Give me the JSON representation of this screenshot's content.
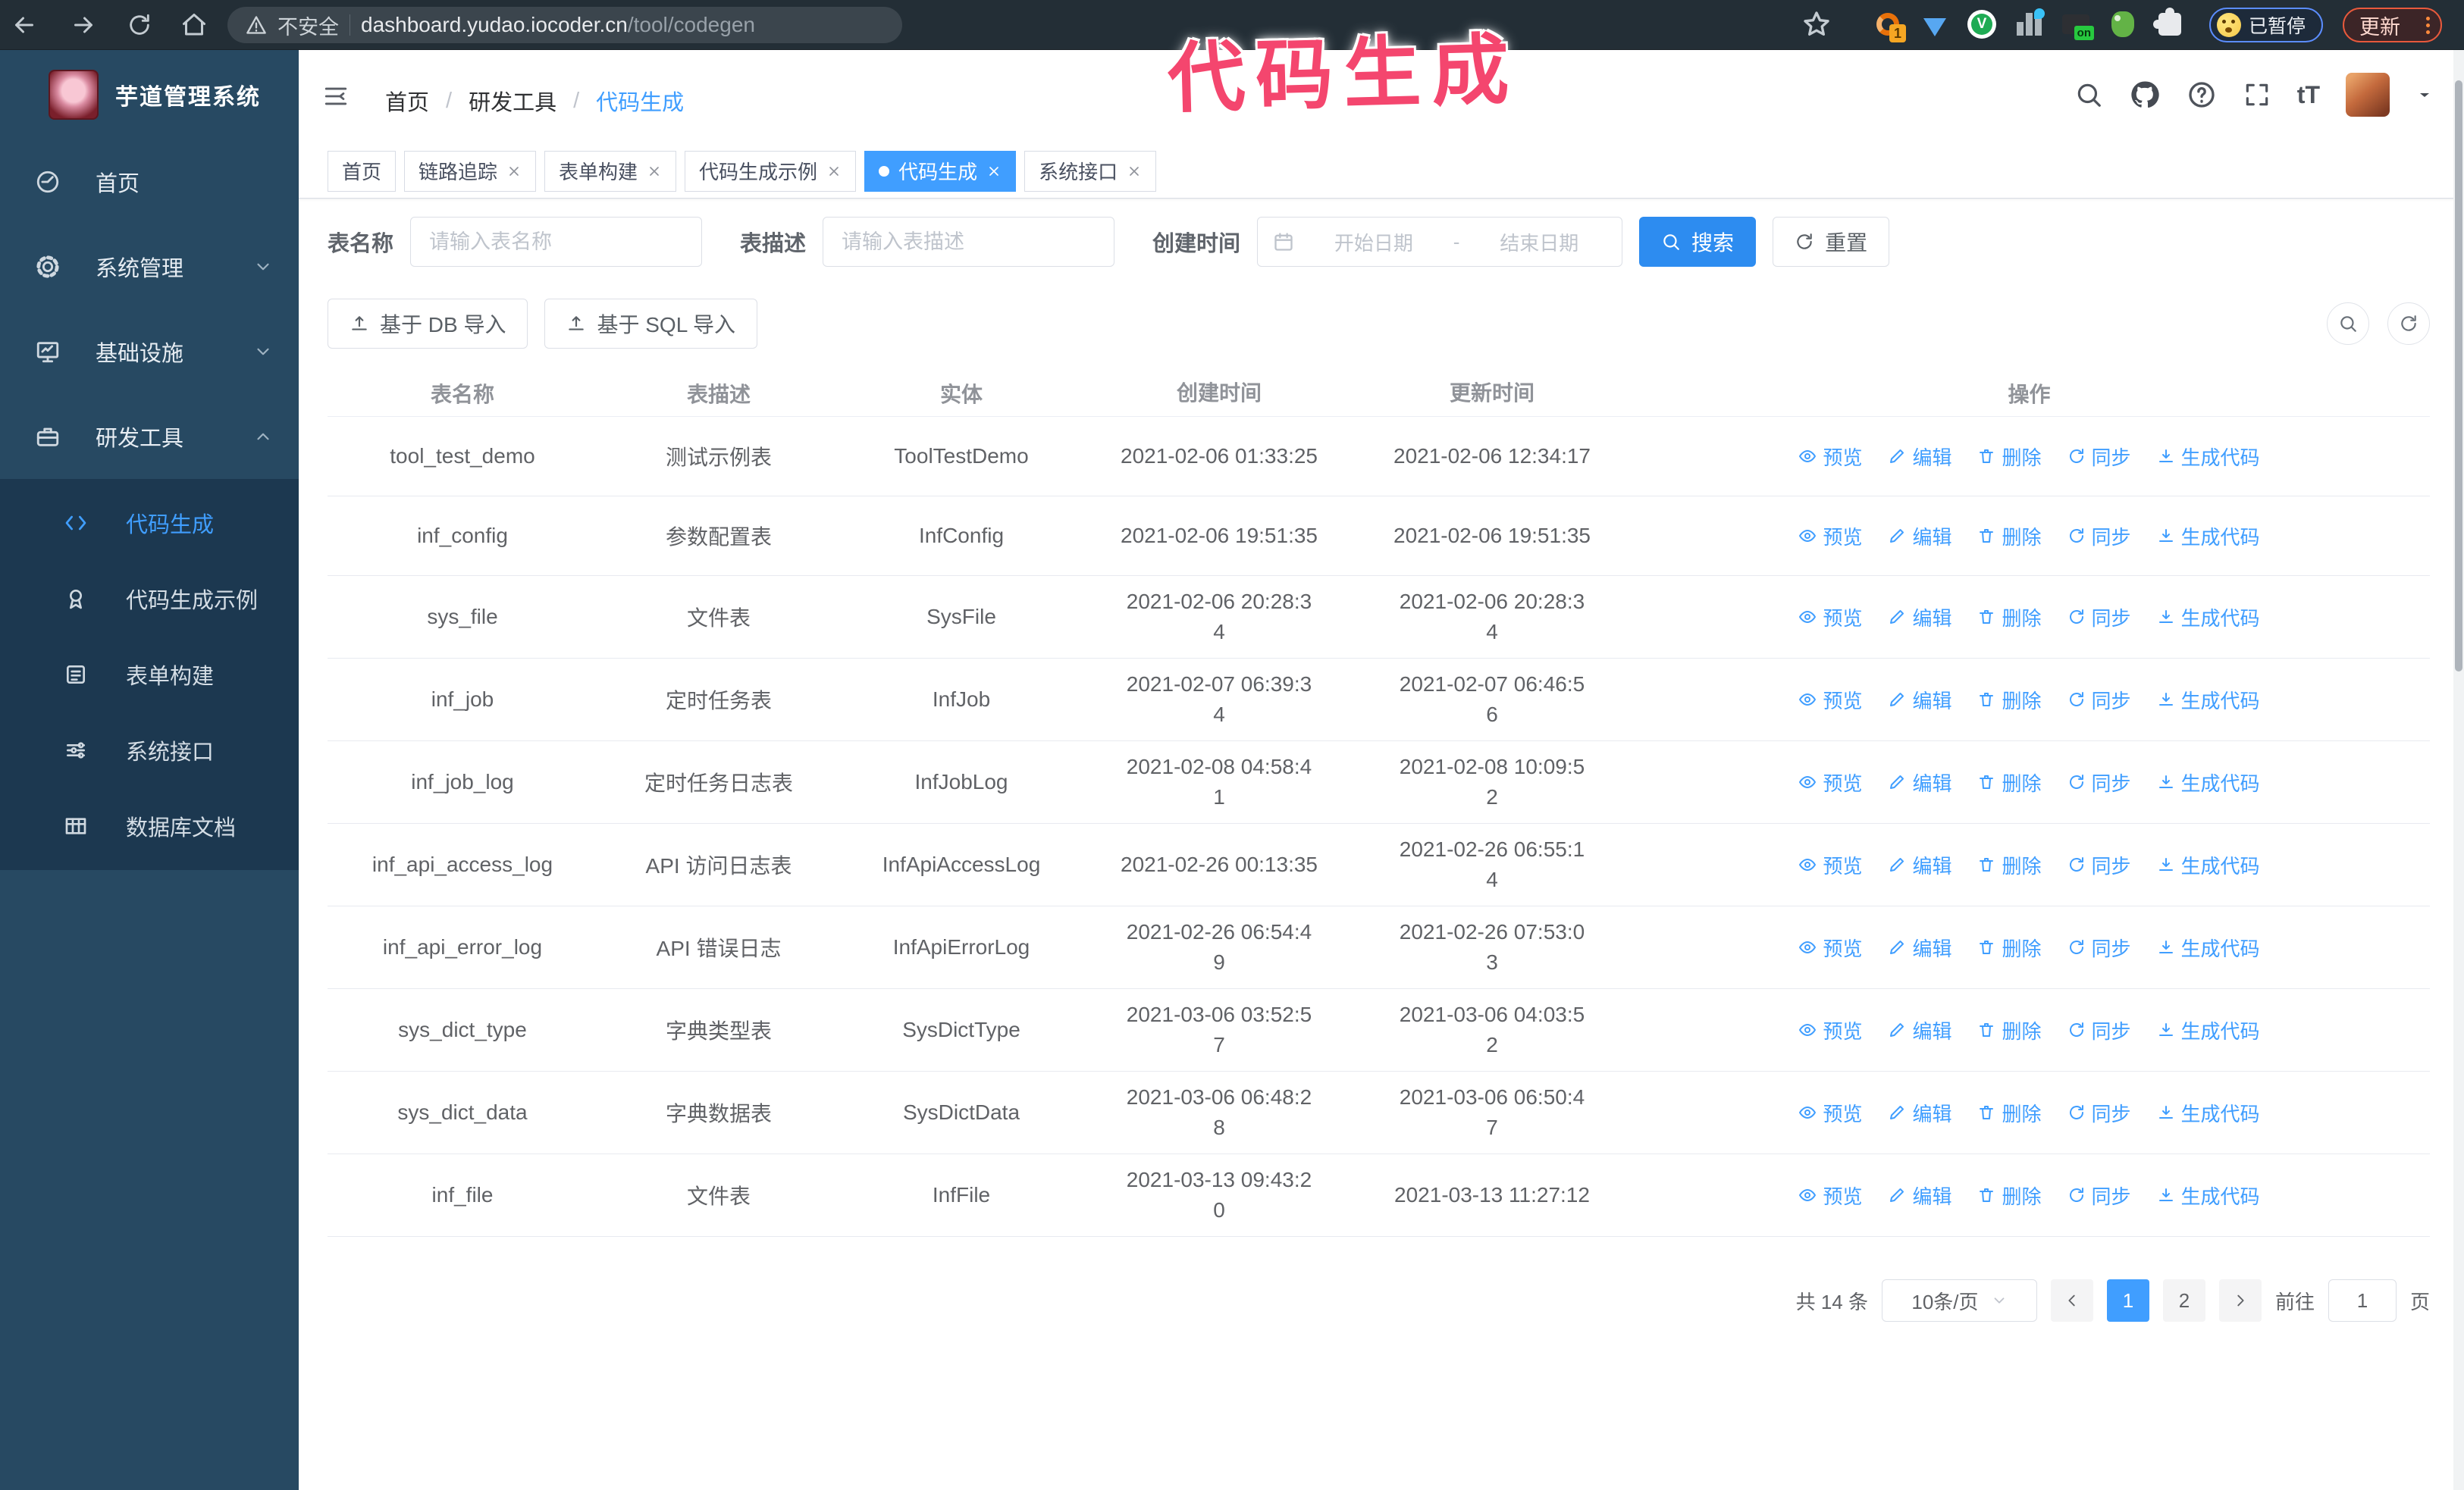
{
  "browser": {
    "security_warning": "不安全",
    "url_domain": "dashboard.yudao.iocoder.cn",
    "url_path": "/tool/codegen",
    "extension_badge_count": "1",
    "extension_on_badge": "on",
    "paused_badge": "已暂停",
    "update_button": "更新"
  },
  "annotation": {
    "text": "代码生成",
    "color": "#f4466e"
  },
  "sidebar": {
    "logo_title": "芋道管理系统",
    "items": [
      {
        "label": "首页"
      },
      {
        "label": "系统管理"
      },
      {
        "label": "基础设施"
      },
      {
        "label": "研发工具"
      }
    ],
    "submenu": [
      {
        "label": "代码生成"
      },
      {
        "label": "代码生成示例"
      },
      {
        "label": "表单构建"
      },
      {
        "label": "系统接口"
      },
      {
        "label": "数据库文档"
      }
    ]
  },
  "header": {
    "breadcrumb": [
      "首页",
      "研发工具",
      "代码生成"
    ],
    "separator": "/"
  },
  "tags": [
    {
      "label": "首页"
    },
    {
      "label": "链路追踪"
    },
    {
      "label": "表单构建"
    },
    {
      "label": "代码生成示例"
    },
    {
      "label": "代码生成"
    },
    {
      "label": "系统接口"
    }
  ],
  "search": {
    "name_label": "表名称",
    "name_placeholder": "请输入表名称",
    "desc_label": "表描述",
    "desc_placeholder": "请输入表描述",
    "time_label": "创建时间",
    "start_placeholder": "开始日期",
    "range_separator": "-",
    "end_placeholder": "结束日期",
    "search_label": "搜索",
    "reset_label": "重置"
  },
  "toolbar": {
    "db_import": "基于 DB 导入",
    "sql_import": "基于 SQL 导入"
  },
  "table": {
    "columns": [
      "表名称",
      "表描述",
      "实体",
      "创建时间",
      "更新时间",
      "操作"
    ],
    "actions": [
      "预览",
      "编辑",
      "删除",
      "同步",
      "生成代码"
    ],
    "rows": [
      {
        "name": "tool_test_demo",
        "desc": "测试示例表",
        "entity": "ToolTestDemo",
        "created": "2021-02-06 01:33:25",
        "updated": "2021-02-06 12:34:17"
      },
      {
        "name": "inf_config",
        "desc": "参数配置表",
        "entity": "InfConfig",
        "created": "2021-02-06 19:51:35",
        "updated": "2021-02-06 19:51:35"
      },
      {
        "name": "sys_file",
        "desc": "文件表",
        "entity": "SysFile",
        "created": "2021-02-06 20:28:3\n4",
        "updated": "2021-02-06 20:28:3\n4"
      },
      {
        "name": "inf_job",
        "desc": "定时任务表",
        "entity": "InfJob",
        "created": "2021-02-07 06:39:3\n4",
        "updated": "2021-02-07 06:46:5\n6"
      },
      {
        "name": "inf_job_log",
        "desc": "定时任务日志表",
        "entity": "InfJobLog",
        "created": "2021-02-08 04:58:4\n1",
        "updated": "2021-02-08 10:09:5\n2"
      },
      {
        "name": "inf_api_access_log",
        "desc": "API 访问日志表",
        "entity": "InfApiAccessLog",
        "created": "2021-02-26 00:13:35",
        "updated": "2021-02-26 06:55:1\n4"
      },
      {
        "name": "inf_api_error_log",
        "desc": "API 错误日志",
        "entity": "InfApiErrorLog",
        "created": "2021-02-26 06:54:4\n9",
        "updated": "2021-02-26 07:53:0\n3"
      },
      {
        "name": "sys_dict_type",
        "desc": "字典类型表",
        "entity": "SysDictType",
        "created": "2021-03-06 03:52:5\n7",
        "updated": "2021-03-06 04:03:5\n2"
      },
      {
        "name": "sys_dict_data",
        "desc": "字典数据表",
        "entity": "SysDictData",
        "created": "2021-03-06 06:48:2\n8",
        "updated": "2021-03-06 06:50:4\n7"
      },
      {
        "name": "inf_file",
        "desc": "文件表",
        "entity": "InfFile",
        "created": "2021-03-13 09:43:2\n0",
        "updated": "2021-03-13 11:27:12"
      }
    ]
  },
  "pagination": {
    "total": "共 14 条",
    "page_size": "10条/页",
    "pages": [
      "1",
      "2"
    ],
    "active_page": "1",
    "goto_label": "前往",
    "goto_value": "1",
    "page_suffix": "页"
  },
  "colors": {
    "accent": "#409eff",
    "primary_button": "#2d8cf0",
    "sidebar_bg": "#274962",
    "submenu_bg": "#1c3850"
  }
}
